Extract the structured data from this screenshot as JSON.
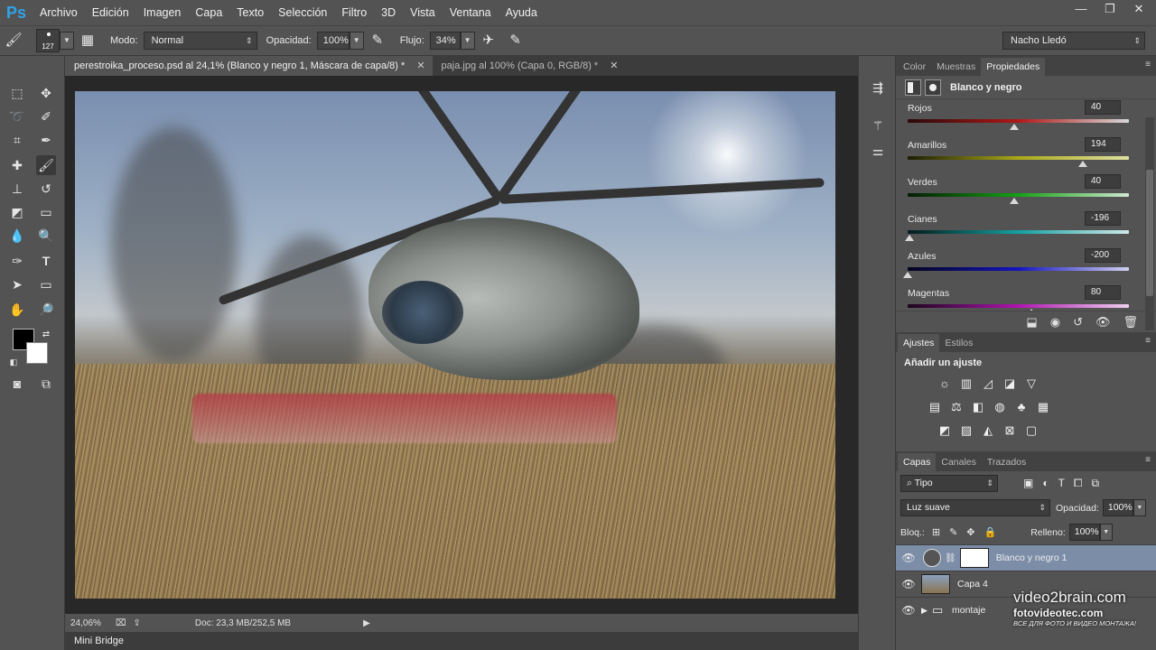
{
  "app": {
    "logo": "Ps"
  },
  "menu": [
    "Archivo",
    "Edición",
    "Imagen",
    "Capa",
    "Texto",
    "Selección",
    "Filtro",
    "3D",
    "Vista",
    "Ventana",
    "Ayuda"
  ],
  "window_controls": {
    "minimize": "—",
    "restore": "❐",
    "close": "✕"
  },
  "options": {
    "brush_size": "127",
    "mode_label": "Modo:",
    "mode_value": "Normal",
    "opacity_label": "Opacidad:",
    "opacity_value": "100%",
    "flow_label": "Flujo:",
    "flow_value": "34%",
    "workspace": "Nacho Lledó"
  },
  "tabs": [
    {
      "title": "perestroika_proceso.psd al 24,1% (Blanco y negro 1, Máscara de capa/8) *",
      "close": "✕"
    },
    {
      "title": "paja.jpg al 100% (Capa 0, RGB/8) *",
      "close": "✕"
    }
  ],
  "status": {
    "zoom": "24,06%",
    "doc": "Doc: 23,3 MB/252,5 MB"
  },
  "mini_bridge": "Mini Bridge",
  "properties_panel": {
    "tabs": [
      "Color",
      "Muestras",
      "Propiedades"
    ],
    "active_tab": 2,
    "title": "Blanco y negro",
    "sliders": [
      {
        "label": "Rojos",
        "value": "40",
        "pos": 0.48,
        "gradient": "linear-gradient(to right,#2a0a0a,#b01818,#d8d8d8)"
      },
      {
        "label": "Amarillos",
        "value": "194",
        "pos": 0.79,
        "gradient": "linear-gradient(to right,#1c1c04,#a8a818,#e0e0a0)"
      },
      {
        "label": "Verdes",
        "value": "40",
        "pos": 0.48,
        "gradient": "linear-gradient(to right,#051c05,#14a014,#d0e8d0)"
      },
      {
        "label": "Cianes",
        "value": "-196",
        "pos": 0.01,
        "gradient": "linear-gradient(to right,#041c1c,#14a0a0,#d0e8e8)"
      },
      {
        "label": "Azules",
        "value": "-200",
        "pos": 0.0,
        "gradient": "linear-gradient(to right,#04041c,#1414c0,#d0d0f0)"
      },
      {
        "label": "Magentas",
        "value": "80",
        "pos": 0.56,
        "gradient": "linear-gradient(to right,#1c041c,#b014b0,#f0d0f0)"
      }
    ]
  },
  "adjustments_panel": {
    "tabs": [
      "Ajustes",
      "Estilos"
    ],
    "active_tab": 0,
    "title": "Añadir un ajuste"
  },
  "layers_panel": {
    "tabs": [
      "Capas",
      "Canales",
      "Trazados"
    ],
    "active_tab": 0,
    "filter": "Tipo",
    "blend_mode": "Luz suave",
    "opacity_label": "Opacidad:",
    "opacity_value": "100%",
    "lock_label": "Bloq.:",
    "fill_label": "Relleno:",
    "fill_value": "100%",
    "layers": [
      {
        "name": "Blanco y negro 1",
        "selected": true,
        "kind": "adjustment"
      },
      {
        "name": "Capa 4",
        "selected": false,
        "kind": "image"
      },
      {
        "name": "montaje",
        "selected": false,
        "kind": "group"
      }
    ]
  },
  "watermark": {
    "line1": "video2brain.com",
    "line2": "fotovideotec.com",
    "line3": "ВСЕ ДЛЯ ФОТО И ВИДЕО МОНТАЖА!"
  },
  "colors": {
    "accent_blue": "#2fa3e8",
    "panel_bg": "#535353",
    "selected_layer": "#7c8da8"
  }
}
